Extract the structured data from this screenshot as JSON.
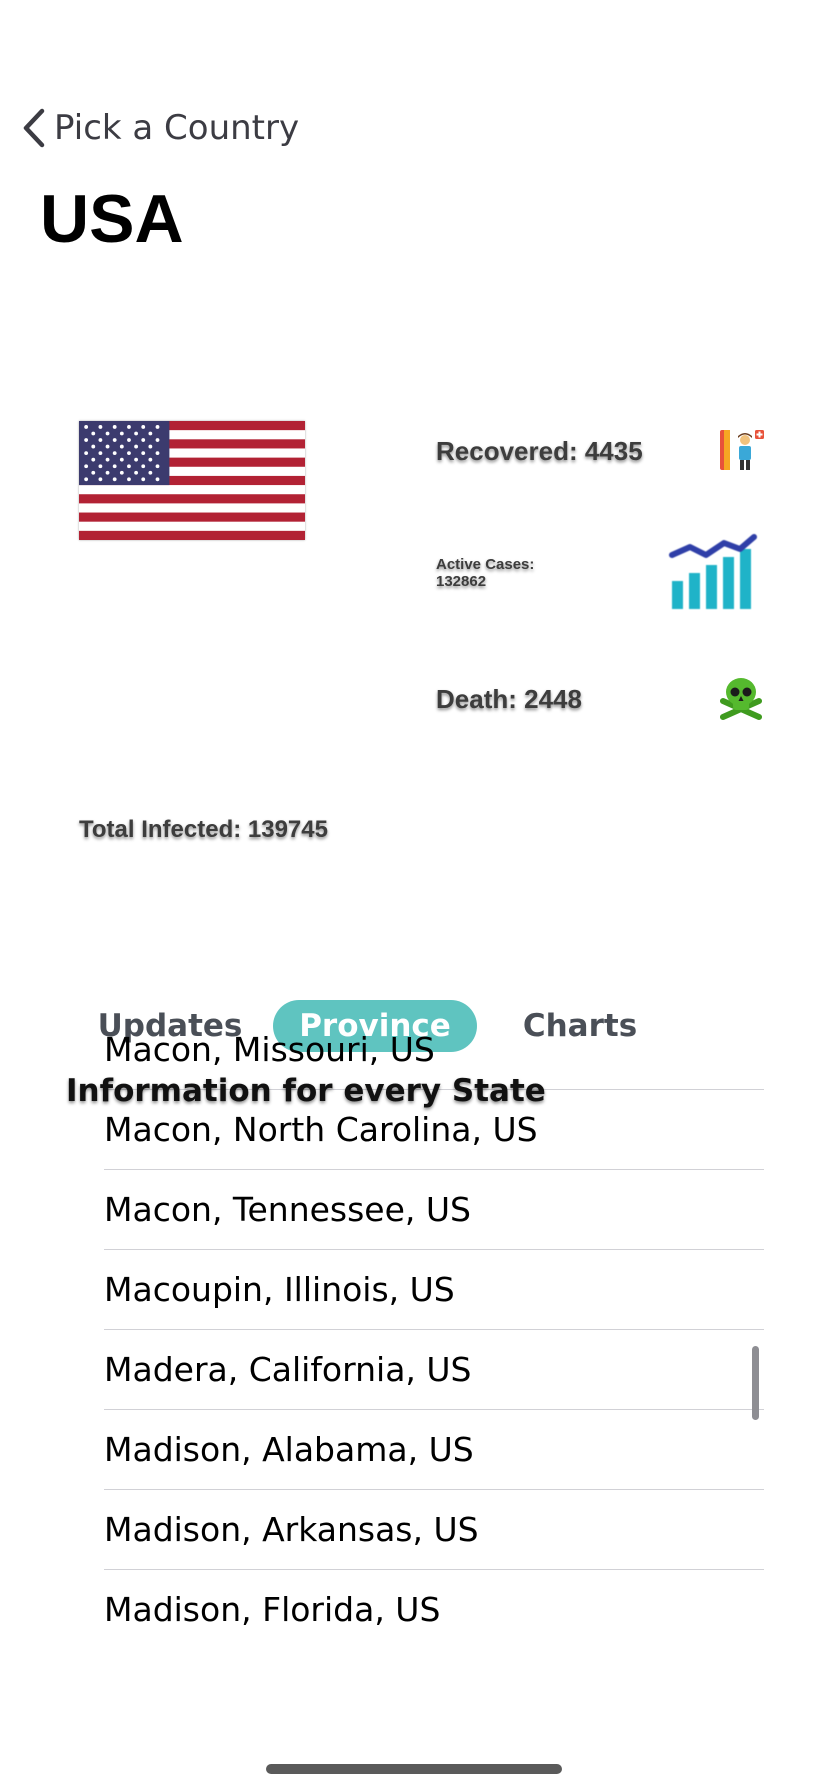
{
  "nav": {
    "back_label": "Pick a Country",
    "back_icon": "chevron-left-icon"
  },
  "page": {
    "title": "USA"
  },
  "flag": {
    "icon": "us-flag"
  },
  "stats": {
    "recovered": "Recovered: 4435",
    "active": "Active Cases: 132862",
    "death": "Death: 2448",
    "total": "Total Infected: 139745"
  },
  "tabs": [
    {
      "label": "Updates",
      "selected": false
    },
    {
      "label": "Province",
      "selected": true
    },
    {
      "label": "Charts",
      "selected": false
    }
  ],
  "section": {
    "header": "Information for every State"
  },
  "list": {
    "items": [
      "Macon, Missouri, US",
      "Macon, North Carolina, US",
      "Macon, Tennessee, US",
      "Macoupin, Illinois, US",
      "Madera, California, US",
      "Madison, Alabama, US",
      "Madison, Arkansas, US",
      "Madison, Florida, US"
    ]
  },
  "colors": {
    "accent": "#5fc4c0",
    "flag_red": "#b22234",
    "flag_blue": "#3c3b6e"
  }
}
